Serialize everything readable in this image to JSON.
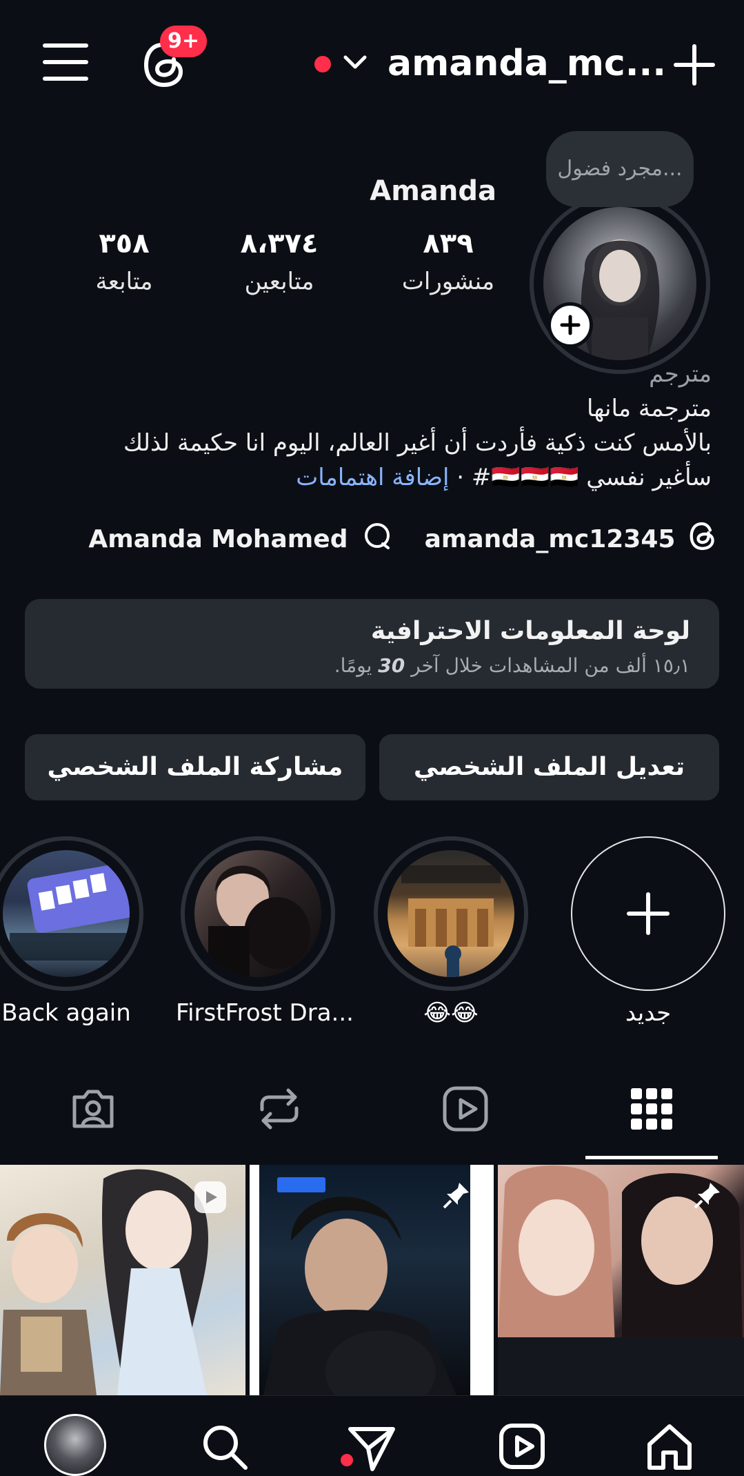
{
  "header": {
    "notification_count": "9+",
    "username": "amanda_mc..."
  },
  "note": {
    "text": "مجرد فضول..."
  },
  "profile": {
    "display_name": "Amanda",
    "stats": [
      {
        "value": "٨٣٩",
        "label": "منشورات"
      },
      {
        "value": "٨،٣٧٤",
        "label": "متابعين"
      },
      {
        "value": "٣٥٨",
        "label": "متابعة"
      }
    ],
    "category": "مترجم",
    "bio_line1": "مترجمة مانها",
    "bio_line2": "بالأمس كنت ذكية فأردت أن أغير العالم، اليوم انا حكيمة لذلك",
    "bio_line3_main": "سأغير نفسي 🇪🇬🇪🇬🇪🇬#",
    "bio_line3_sep": "·",
    "bio_line3_link": "إضافة اهتمامات",
    "threads_name": "Amanda Mohamed",
    "threads_handle": "amanda_mc12345"
  },
  "dashboard": {
    "title": "لوحة المعلومات الاحترافية",
    "subtitle_pre": "١٥٫١ ألف من المشاهدات خلال آخر",
    "subtitle_bold": "30",
    "subtitle_post": "يومًا."
  },
  "buttons": {
    "edit": "تعديل الملف الشخصي",
    "share": "مشاركة الملف الشخصي"
  },
  "highlights": [
    {
      "label": "جديد"
    },
    {
      "label": "😂😂"
    },
    {
      "label": "FirstFrost Dra..."
    },
    {
      "label": "Back again"
    }
  ],
  "colors": {
    "background": "#0b0f15",
    "accent_red": "#ff2e4a",
    "link_blue": "#8ab4ff",
    "card": "#262a31"
  }
}
